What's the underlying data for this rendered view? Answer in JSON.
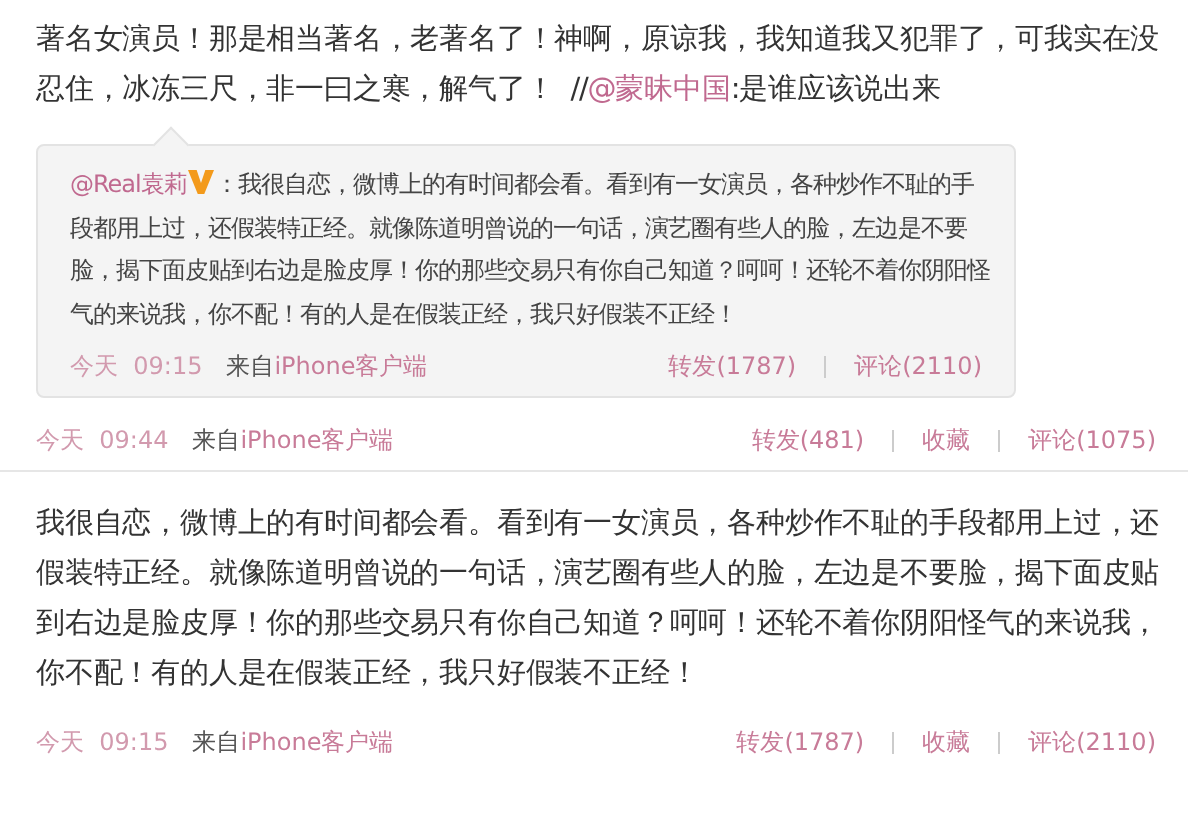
{
  "posts": [
    {
      "text": "著名女演员！那是相当著名，老著名了！神啊，原谅我，我知道我又犯罪了，可我实在没忍住，冰冻三尺，非一曰之寒，解气了！  //",
      "mention": "@蒙昧中国",
      "text_after": ":是谁应该说出来",
      "quote": {
        "author": "@Real袁莉",
        "verified": true,
        "text": "：我很自恋，微博上的有时间都会看。看到有一女演员，各种炒作不耻的手段都用上过，还假装特正经。就像陈道明曾说的一句话，演艺圈有些人的脸，左边是不要脸，揭下面皮贴到右边是脸皮厚！你的那些交易只有你自己知道？呵呵！还轮不着你阴阳怪气的来说我，你不配！有的人是在假装正经，我只好假装不正经！",
        "footer": {
          "time": "今天  09:15",
          "source_prefix": "来自",
          "source": "iPhone客户端",
          "actions": [
            "转发(1787)",
            "评论(2110)"
          ]
        }
      },
      "footer": {
        "time": "今天  09:44",
        "source_prefix": "来自",
        "source": "iPhone客户端",
        "actions": [
          "转发(481)",
          "收藏",
          "评论(1075)"
        ]
      }
    },
    {
      "text": "我很自恋，微博上的有时间都会看。看到有一女演员，各种炒作不耻的手段都用上过，还假装特正经。就像陈道明曾说的一句话，演艺圈有些人的脸，左边是不要脸，揭下面皮贴到右边是脸皮厚！你的那些交易只有你自己知道？呵呵！还轮不着你阴阳怪气的来说我，你不配！有的人是在假装正经，我只好假装不正经！",
      "footer": {
        "time": "今天  09:15",
        "source_prefix": "来自",
        "source": "iPhone客户端",
        "actions": [
          "转发(1787)",
          "收藏",
          "评论(2110)"
        ]
      }
    }
  ]
}
